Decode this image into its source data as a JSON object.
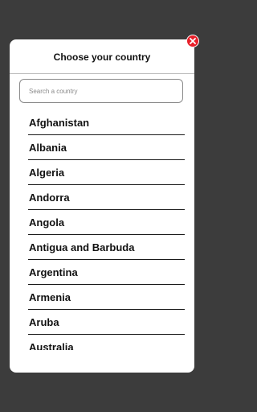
{
  "modal": {
    "title": "Choose your country"
  },
  "search": {
    "placeholder": "Search a country",
    "value": ""
  },
  "close": {
    "icon": "close-icon",
    "color": "#e8202a"
  },
  "countries": [
    "Afghanistan",
    "Albania",
    "Algeria",
    "Andorra",
    "Angola",
    "Antigua and Barbuda",
    "Argentina",
    "Armenia",
    "Aruba",
    "Australia"
  ]
}
